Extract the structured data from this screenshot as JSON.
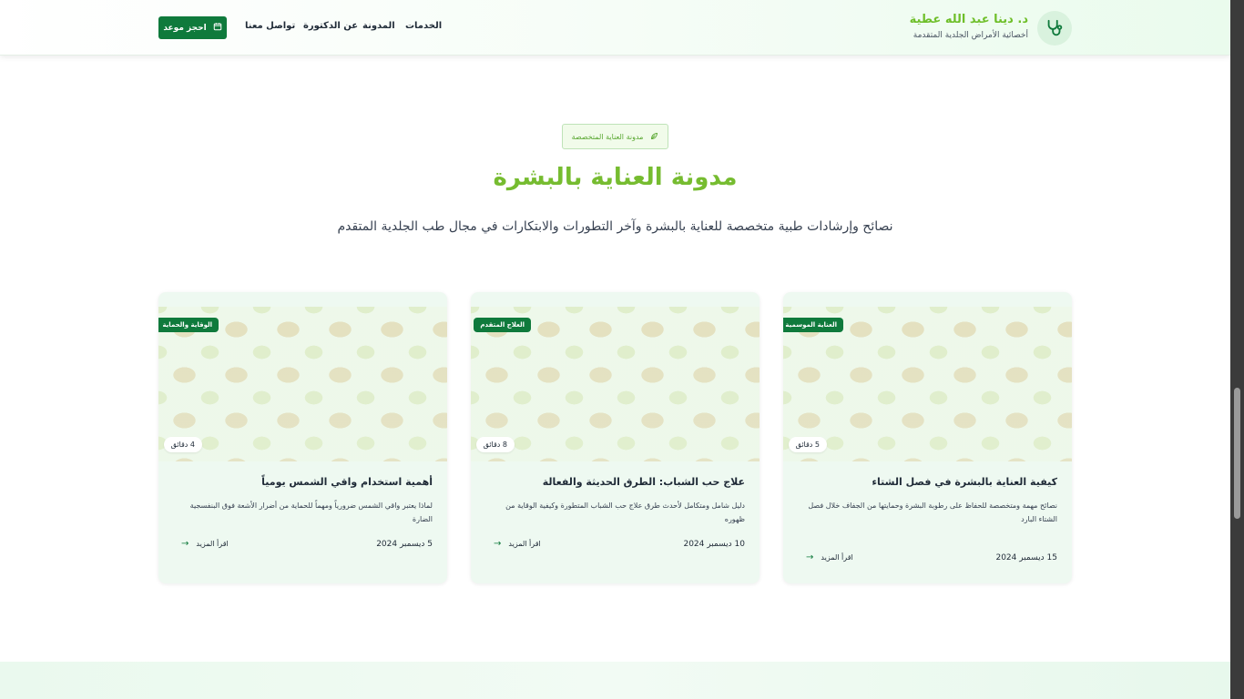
{
  "header": {
    "brand_name": "د. دينا عبد الله عطية",
    "brand_subtitle": "أخصائية الأمراض الجلدية المتقدمة",
    "logo_icon": "stethoscope-icon",
    "nav": {
      "services": "الخدمات",
      "blog": "المدونة",
      "about": "عن الدكتورة",
      "contact": "تواصل معنا"
    },
    "book_button": "احجز موعد",
    "book_icon": "calendar-icon"
  },
  "section": {
    "badge": "مدونة العناية المتخصصة",
    "badge_icon": "leaf-icon",
    "title": "مدونة العناية بالبشرة",
    "subtitle": "نصائح وإرشادات طبية متخصصة للعناية بالبشرة وآخر التطورات والابتكارات في مجال طب الجلدية المتقدم"
  },
  "cards": [
    {
      "category": "العناية الموسمية",
      "read_time": "5 دقائق",
      "title": "كيفية العناية بالبشرة في فصل الشتاء",
      "description": "نصائح مهمة ومتخصصة للحفاظ على رطوبة البشرة وحمايتها من الجفاف خلال فصل الشتاء البارد",
      "date": "15 ديسمبر 2024",
      "read_more": "اقرأ المزيد"
    },
    {
      "category": "العلاج المتقدم",
      "read_time": "8 دقائق",
      "title": "علاج حب الشباب: الطرق الحديثة والفعالة",
      "description": "دليل شامل ومتكامل لأحدث طرق علاج حب الشباب المتطورة وكيفية الوقاية من ظهوره",
      "date": "10 ديسمبر 2024",
      "read_more": "اقرأ المزيد"
    },
    {
      "category": "الوقاية والحماية",
      "read_time": "4 دقائق",
      "title": "أهمية استخدام واقي الشمس يومياً",
      "description": "لماذا يعتبر واقي الشمس ضرورياً ومهماً للحماية من أضرار الأشعة فوق البنفسجية الضارة",
      "date": "5 ديسمبر 2024",
      "read_more": "اقرأ المزيد"
    }
  ],
  "colors": {
    "brand_green": "#76bc30",
    "dark_green": "#0f7a3c",
    "card_bg": "#eef9f1"
  }
}
